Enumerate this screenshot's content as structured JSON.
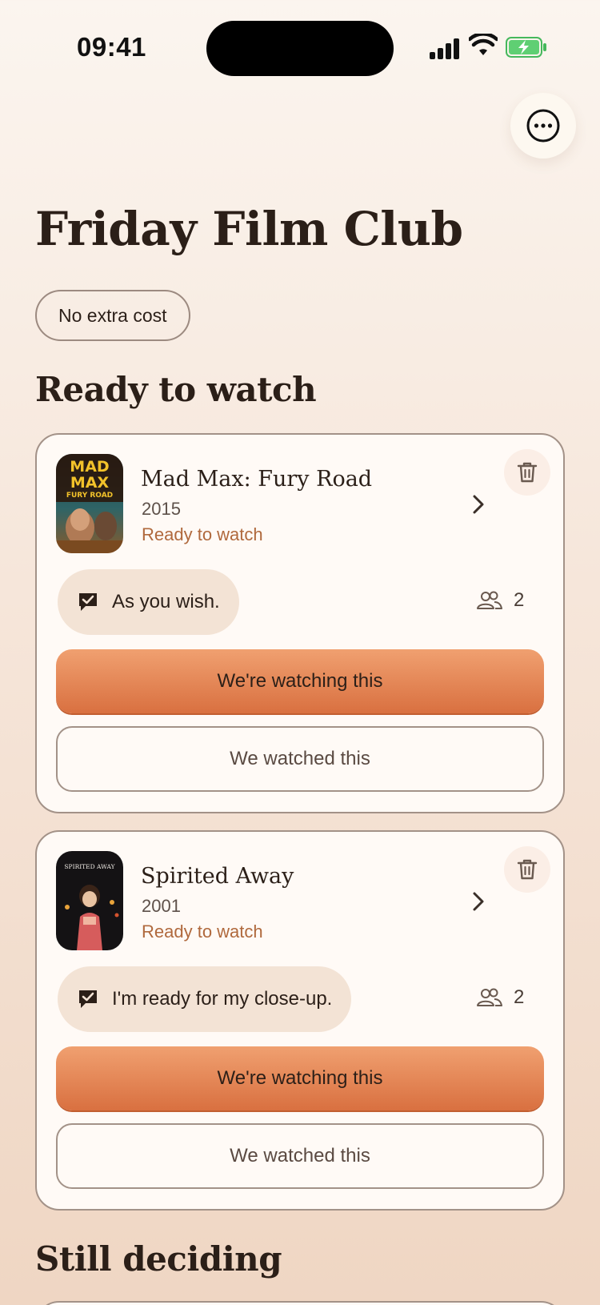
{
  "status_bar": {
    "time": "09:41"
  },
  "header": {
    "title": "Friday Film Club",
    "cost_badge": "No extra cost"
  },
  "sections": [
    {
      "title": "Ready to watch",
      "movies": [
        {
          "title": "Mad Max: Fury Road",
          "year": "2015",
          "status": "Ready to watch",
          "poster_text_line1": "MAD",
          "poster_text_line2": "MAX",
          "poster_text_line3": "FURY ROAD",
          "quote": "As you wish.",
          "member_count": "2",
          "primary_action": "We're watching this",
          "secondary_action": "We watched this"
        },
        {
          "title": "Spirited Away",
          "year": "2001",
          "status": "Ready to watch",
          "poster_text_line1": "SPIRITED AWAY",
          "quote": "I'm ready for my close-up.",
          "member_count": "2",
          "primary_action": "We're watching this",
          "secondary_action": "We watched this"
        }
      ]
    },
    {
      "title": "Still deciding"
    }
  ],
  "colors": {
    "accent": "#d97040",
    "status_text": "#b0693d",
    "quote_pill": "#f3e3d5"
  },
  "icons": {
    "more": "more-options-icon",
    "delete": "trash-icon",
    "open": "chevron-right-icon",
    "vote": "checked-message-icon",
    "members": "people-icon"
  }
}
